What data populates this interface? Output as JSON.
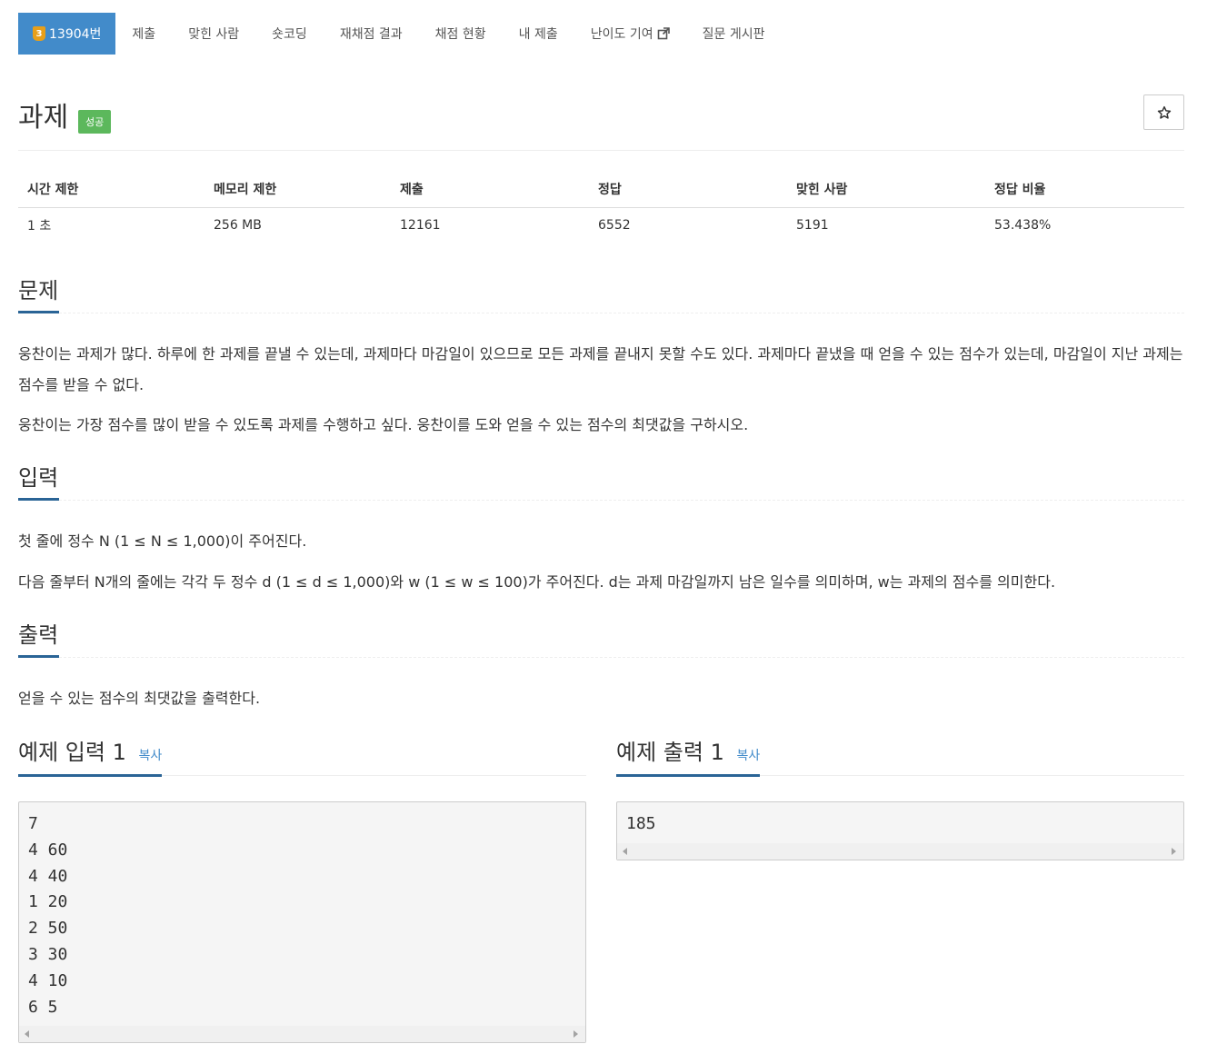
{
  "nav": {
    "problem_tab": {
      "tier": "3",
      "label": "13904번"
    },
    "tabs": [
      {
        "label": "제출"
      },
      {
        "label": "맞힌 사람"
      },
      {
        "label": "숏코딩"
      },
      {
        "label": "재채점 결과"
      },
      {
        "label": "채점 현황"
      },
      {
        "label": "내 제출"
      },
      {
        "label": "난이도 기여"
      },
      {
        "label": "질문 게시판"
      }
    ]
  },
  "problem": {
    "title": "과제",
    "result_badge": "성공",
    "star_icon": "star-icon"
  },
  "info": {
    "headers": [
      "시간 제한",
      "메모리 제한",
      "제출",
      "정답",
      "맞힌 사람",
      "정답 비율"
    ],
    "values": [
      "1 초",
      "256 MB",
      "12161",
      "6552",
      "5191",
      "53.438%"
    ]
  },
  "sections": {
    "description": {
      "heading": "문제",
      "paragraphs": [
        "웅찬이는 과제가 많다. 하루에 한 과제를 끝낼 수 있는데, 과제마다 마감일이 있으므로 모든 과제를 끝내지 못할 수도 있다. 과제마다 끝냈을 때 얻을 수 있는 점수가 있는데, 마감일이 지난 과제는 점수를 받을 수 없다.",
        "웅찬이는 가장 점수를 많이 받을 수 있도록 과제를 수행하고 싶다. 웅찬이를 도와 얻을 수 있는 점수의 최댓값을 구하시오."
      ]
    },
    "input": {
      "heading": "입력",
      "paragraphs": [
        "첫 줄에 정수 N (1 ≤ N ≤ 1,000)이 주어진다.",
        "다음 줄부터 N개의 줄에는 각각 두 정수 d (1 ≤ d ≤ 1,000)와 w (1 ≤ w ≤ 100)가 주어진다. d는 과제 마감일까지 남은 일수를 의미하며, w는 과제의 점수를 의미한다."
      ]
    },
    "output": {
      "heading": "출력",
      "paragraphs": [
        "얻을 수 있는 점수의 최댓값을 출력한다."
      ]
    }
  },
  "samples": {
    "input": {
      "heading": "예제 입력 1",
      "copy_label": "복사",
      "lines": [
        "7",
        "4 60",
        "4 40",
        "1 20",
        "2 50",
        "3 30",
        "4 10",
        "6 5"
      ]
    },
    "output": {
      "heading": "예제 출력 1",
      "copy_label": "복사",
      "lines": [
        "185"
      ]
    }
  }
}
